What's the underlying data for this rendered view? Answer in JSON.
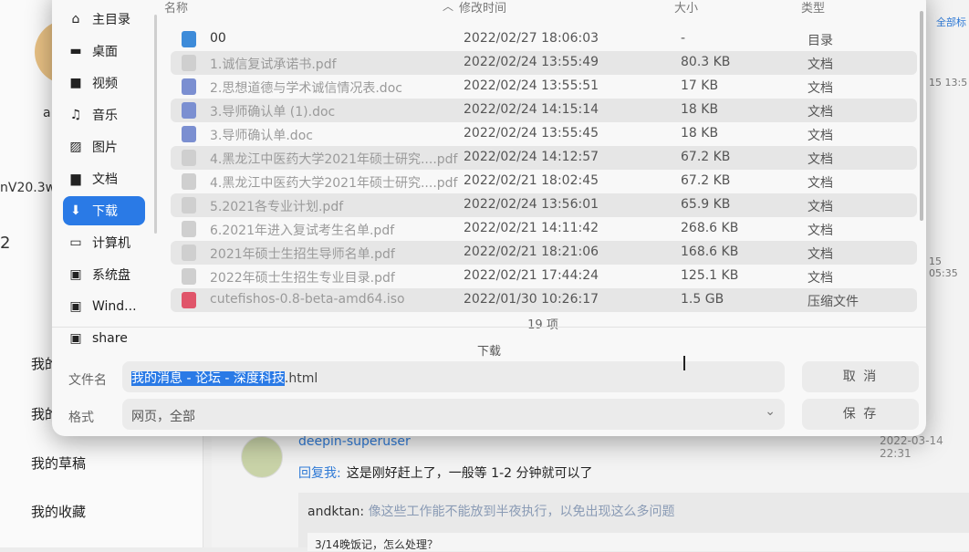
{
  "background": {
    "left_fragments": [
      "a",
      "nV20.3wi",
      "2"
    ],
    "menu": [
      "我的",
      "我的",
      "我的草稿",
      "我的收藏"
    ],
    "side_times": [
      "15 13:5",
      "15 05:35"
    ],
    "side_link": "全部标",
    "thread": {
      "user": "deepin-superuser",
      "time": "2022-03-14 22:31",
      "reply_prefix": "回复我:",
      "reply_text": "这是刚好赶上了，一般等 1-2 分钟就可以了",
      "quote_user": "andktan:",
      "quote_text": "像这些工作能不能放到半夜执行，以免出现这么多问题",
      "quote2": "3/14晚饭记，怎么处理？"
    }
  },
  "dialog": {
    "sidebar": [
      {
        "label": "主目录",
        "icon": "home-icon",
        "glyph": "⌂"
      },
      {
        "label": "桌面",
        "icon": "desktop-icon",
        "glyph": "▬"
      },
      {
        "label": "视频",
        "icon": "video-icon",
        "glyph": "■"
      },
      {
        "label": "音乐",
        "icon": "music-icon",
        "glyph": "♫"
      },
      {
        "label": "图片",
        "icon": "picture-icon",
        "glyph": "▨"
      },
      {
        "label": "文档",
        "icon": "document-icon",
        "glyph": "▆"
      },
      {
        "label": "下载",
        "icon": "download-icon",
        "glyph": "⬇",
        "active": true
      },
      {
        "label": "计算机",
        "icon": "computer-icon",
        "glyph": "▭"
      },
      {
        "label": "系统盘",
        "icon": "disk-icon",
        "glyph": "▣"
      },
      {
        "label": "Wind...",
        "icon": "drive-icon",
        "glyph": "▣"
      },
      {
        "label": "share",
        "icon": "share-drive-icon",
        "glyph": "▣"
      }
    ],
    "columns": {
      "name": "名称",
      "modified": "修改时间",
      "size": "大小",
      "type": "类型"
    },
    "files": [
      {
        "name": "00",
        "date": "2022/02/27 18:06:03",
        "size": "-",
        "type": "目录",
        "kind": "folder"
      },
      {
        "name": "1.诚信复试承诺书.pdf",
        "date": "2022/02/24 13:55:49",
        "size": "80.3 KB",
        "type": "文档",
        "kind": "pdf"
      },
      {
        "name": "2.思想道德与学术诚信情况表.doc",
        "date": "2022/02/24 13:55:51",
        "size": "17 KB",
        "type": "文档",
        "kind": "doc"
      },
      {
        "name": "3.导师确认单 (1).doc",
        "date": "2022/02/24 14:15:14",
        "size": "18 KB",
        "type": "文档",
        "kind": "doc"
      },
      {
        "name": "3.导师确认单.doc",
        "date": "2022/02/24 13:55:45",
        "size": "18 KB",
        "type": "文档",
        "kind": "doc"
      },
      {
        "name": "4.黑龙江中医药大学2021年硕士研究....pdf",
        "date": "2022/02/24 14:12:57",
        "size": "67.2 KB",
        "type": "文档",
        "kind": "pdf"
      },
      {
        "name": "4.黑龙江中医药大学2021年硕士研究....pdf",
        "date": "2022/02/21 18:02:45",
        "size": "67.2 KB",
        "type": "文档",
        "kind": "pdf"
      },
      {
        "name": "5.2021各专业计划.pdf",
        "date": "2022/02/24 13:56:01",
        "size": "65.9 KB",
        "type": "文档",
        "kind": "pdf"
      },
      {
        "name": "6.2021年进入复试考生名单.pdf",
        "date": "2022/02/21 14:11:42",
        "size": "268.6 KB",
        "type": "文档",
        "kind": "pdf"
      },
      {
        "name": "2021年硕士生招生导师名单.pdf",
        "date": "2022/02/21 18:21:06",
        "size": "168.6 KB",
        "type": "文档",
        "kind": "pdf"
      },
      {
        "name": "2022年硕士生招生专业目录.pdf",
        "date": "2022/02/21 17:44:24",
        "size": "125.1 KB",
        "type": "文档",
        "kind": "pdf"
      },
      {
        "name": "cutefishos-0.8-beta-amd64.iso",
        "date": "2022/01/30 10:26:17",
        "size": "1.5 GB",
        "type": "压缩文件",
        "kind": "iso"
      }
    ],
    "item_count": "19 项",
    "location": "下载",
    "filename_label": "文件名",
    "filename_selected": "我的消息 - 论坛 - 深度科技",
    "filename_ext": ".html",
    "format_label": "格式",
    "format_value": "网页，全部",
    "cancel": "取 消",
    "save": "保 存"
  },
  "colors": {
    "accent": "#2a7ae6",
    "folder": "#3d8bd9",
    "doc": "#7b8fd1",
    "pdf": "#cfcfcf",
    "iso": "#e0556a"
  }
}
